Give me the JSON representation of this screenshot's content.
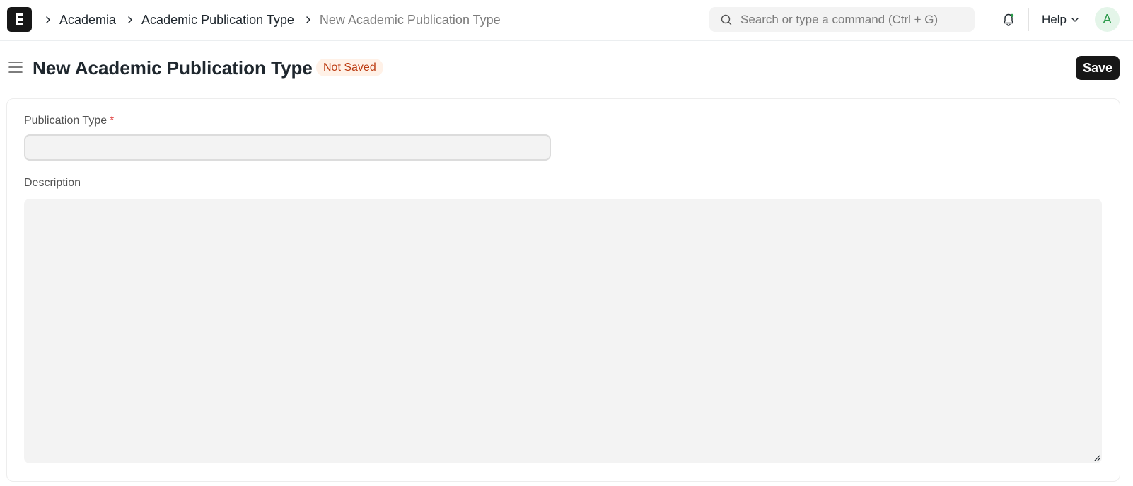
{
  "navbar": {
    "breadcrumbs": [
      "Academia",
      "Academic Publication Type",
      "New Academic Publication Type"
    ],
    "search_placeholder": "Search or type a command (Ctrl + G)",
    "help_label": "Help",
    "avatar_initial": "A"
  },
  "page": {
    "title": "New Academic Publication Type",
    "status_badge": "Not Saved",
    "save_label": "Save"
  },
  "form": {
    "publication_type_label": "Publication Type",
    "required_marker": "*",
    "publication_type_value": "",
    "description_label": "Description",
    "description_value": ""
  },
  "colors": {
    "primary_button": "#171717",
    "badge_bg": "#fff1e7",
    "badge_text": "#bc3c12",
    "input_bg": "#f3f3f3",
    "avatar_bg": "#e4f5e9",
    "avatar_text": "#2c9a4b"
  },
  "icons": {
    "logo": "app-logo-icon",
    "separator": "chevron-right-icon",
    "search": "search-icon",
    "notifications": "bell-icon",
    "help_dropdown": "chevron-down-icon",
    "sidebar_toggle": "hamburger-icon"
  }
}
